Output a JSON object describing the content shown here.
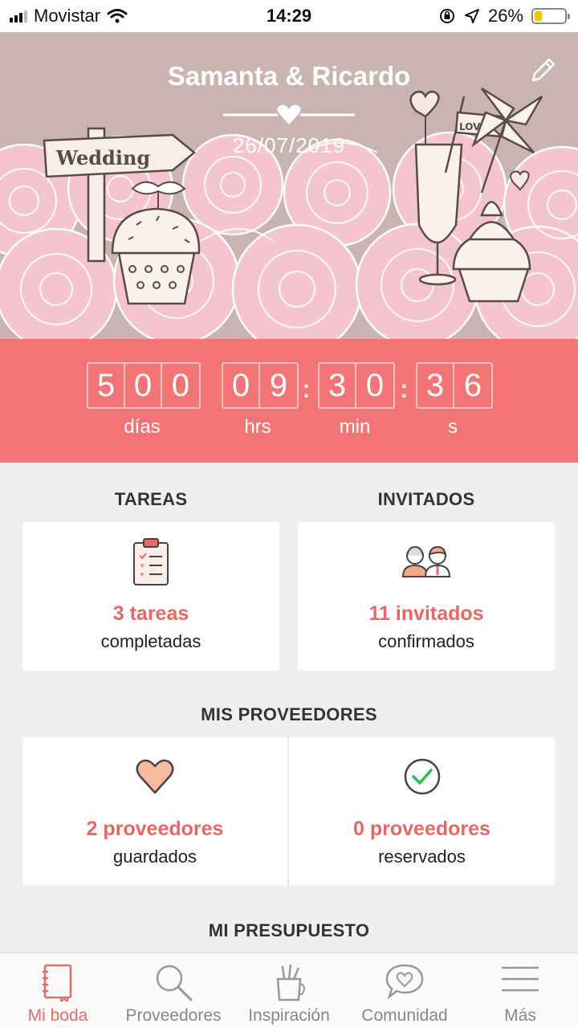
{
  "status_bar": {
    "carrier": "Movistar",
    "time": "14:29",
    "battery": "26%",
    "battery_level": 0.26
  },
  "header": {
    "couple": "Samanta & Ricardo",
    "date": "26/07/2019"
  },
  "countdown": {
    "days": [
      "5",
      "0",
      "0"
    ],
    "hours": [
      "0",
      "9"
    ],
    "minutes": [
      "3",
      "0"
    ],
    "seconds": [
      "3",
      "6"
    ],
    "labels": {
      "days": "días",
      "hours": "hrs",
      "minutes": "min",
      "seconds": "s"
    }
  },
  "tasks": {
    "title": "TAREAS",
    "count": "3 tareas",
    "status": "completadas"
  },
  "guests": {
    "title": "INVITADOS",
    "count": "11 invitados",
    "status": "confirmados"
  },
  "vendors": {
    "title": "MIS PROVEEDORES",
    "saved": {
      "count": "2 proveedores",
      "status": "guardados"
    },
    "booked": {
      "count": "0 proveedores",
      "status": "reservados"
    }
  },
  "budget": {
    "title": "MI PRESUPUESTO"
  },
  "tabs": [
    {
      "label": "Mi boda",
      "icon": "notebook-icon",
      "active": true
    },
    {
      "label": "Proveedores",
      "icon": "search-icon",
      "active": false
    },
    {
      "label": "Inspiración",
      "icon": "pencil-cup-icon",
      "active": false
    },
    {
      "label": "Comunidad",
      "icon": "heart-chat-icon",
      "active": false
    },
    {
      "label": "Más",
      "icon": "menu-icon",
      "active": false
    }
  ],
  "colors": {
    "accent": "#f27474",
    "header_bg": "#c9b4b2",
    "rose": "#f6c6d0",
    "text_accent": "#e76666"
  },
  "illustration": {
    "sign_text": "Wedding",
    "flag_text": "LOVE"
  }
}
